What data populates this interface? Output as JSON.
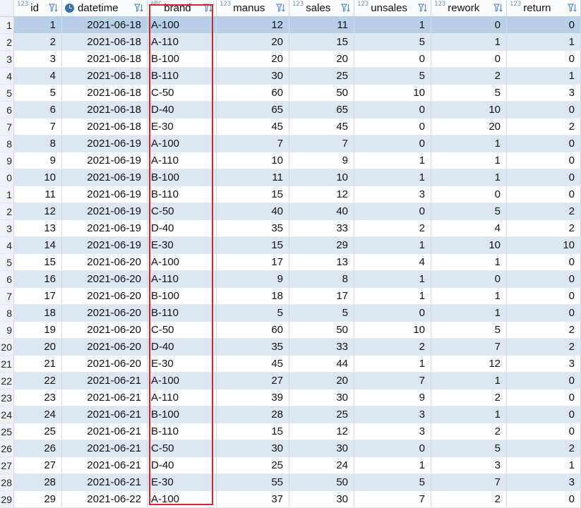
{
  "columns": [
    {
      "name": "id",
      "type_icon": "123",
      "icon": "key-number-icon"
    },
    {
      "name": "datetime",
      "type_icon": "clock",
      "icon": "clock-icon"
    },
    {
      "name": "brand",
      "type_icon": "ABC",
      "icon": "text-type-icon"
    },
    {
      "name": "manus",
      "type_icon": "123",
      "icon": "number-type-icon"
    },
    {
      "name": "sales",
      "type_icon": "123",
      "icon": "number-type-icon"
    },
    {
      "name": "unsales",
      "type_icon": "123",
      "icon": "number-type-icon"
    },
    {
      "name": "rework",
      "type_icon": "123",
      "icon": "number-type-icon"
    },
    {
      "name": "return",
      "type_icon": "123",
      "icon": "number-type-icon"
    }
  ],
  "row_numbers": [
    "1",
    "2",
    "3",
    "4",
    "5",
    "6",
    "7",
    "8",
    "9",
    "0",
    "1",
    "2",
    "3",
    "4",
    "5",
    "6",
    "7",
    "8",
    "9",
    "20",
    "21",
    "22",
    "23",
    "24",
    "25",
    "26",
    "27",
    "28",
    "29"
  ],
  "rows": [
    [
      "1",
      "2021-06-18",
      "A-100",
      "12",
      "11",
      "1",
      "0",
      "0"
    ],
    [
      "2",
      "2021-06-18",
      "A-110",
      "20",
      "15",
      "5",
      "1",
      "1"
    ],
    [
      "3",
      "2021-06-18",
      "B-100",
      "20",
      "20",
      "0",
      "0",
      "0"
    ],
    [
      "4",
      "2021-06-18",
      "B-110",
      "30",
      "25",
      "5",
      "2",
      "1"
    ],
    [
      "5",
      "2021-06-18",
      "C-50",
      "60",
      "50",
      "10",
      "5",
      "3"
    ],
    [
      "6",
      "2021-06-18",
      "D-40",
      "65",
      "65",
      "0",
      "10",
      "0"
    ],
    [
      "7",
      "2021-06-18",
      "E-30",
      "45",
      "45",
      "0",
      "20",
      "2"
    ],
    [
      "8",
      "2021-06-19",
      "A-100",
      "7",
      "7",
      "0",
      "1",
      "0"
    ],
    [
      "9",
      "2021-06-19",
      "A-110",
      "10",
      "9",
      "1",
      "1",
      "0"
    ],
    [
      "10",
      "2021-06-19",
      "B-100",
      "11",
      "10",
      "1",
      "1",
      "0"
    ],
    [
      "11",
      "2021-06-19",
      "B-110",
      "15",
      "12",
      "3",
      "0",
      "0"
    ],
    [
      "12",
      "2021-06-19",
      "C-50",
      "40",
      "40",
      "0",
      "5",
      "2"
    ],
    [
      "13",
      "2021-06-19",
      "D-40",
      "35",
      "33",
      "2",
      "4",
      "2"
    ],
    [
      "14",
      "2021-06-19",
      "E-30",
      "15",
      "29",
      "1",
      "10",
      "10"
    ],
    [
      "15",
      "2021-06-20",
      "A-100",
      "17",
      "13",
      "4",
      "1",
      "0"
    ],
    [
      "16",
      "2021-06-20",
      "A-110",
      "9",
      "8",
      "1",
      "0",
      "0"
    ],
    [
      "17",
      "2021-06-20",
      "B-100",
      "18",
      "17",
      "1",
      "1",
      "0"
    ],
    [
      "18",
      "2021-06-20",
      "B-110",
      "5",
      "5",
      "0",
      "1",
      "0"
    ],
    [
      "19",
      "2021-06-20",
      "C-50",
      "60",
      "50",
      "10",
      "5",
      "2"
    ],
    [
      "20",
      "2021-06-20",
      "D-40",
      "35",
      "33",
      "2",
      "7",
      "2"
    ],
    [
      "21",
      "2021-06-20",
      "E-30",
      "45",
      "44",
      "1",
      "12",
      "3"
    ],
    [
      "22",
      "2021-06-21",
      "A-100",
      "27",
      "20",
      "7",
      "1",
      "0"
    ],
    [
      "23",
      "2021-06-21",
      "A-110",
      "39",
      "30",
      "9",
      "2",
      "0"
    ],
    [
      "24",
      "2021-06-21",
      "B-100",
      "28",
      "25",
      "3",
      "1",
      "0"
    ],
    [
      "25",
      "2021-06-21",
      "B-110",
      "15",
      "12",
      "3",
      "2",
      "0"
    ],
    [
      "26",
      "2021-06-21",
      "C-50",
      "30",
      "30",
      "0",
      "5",
      "2"
    ],
    [
      "27",
      "2021-06-21",
      "D-40",
      "25",
      "24",
      "1",
      "3",
      "1"
    ],
    [
      "28",
      "2021-06-21",
      "E-30",
      "55",
      "50",
      "5",
      "7",
      "3"
    ],
    [
      "29",
      "2021-06-22",
      "A-100",
      "37",
      "30",
      "7",
      "2",
      "0"
    ]
  ],
  "colors": {
    "selected_row": "#b8cfe8",
    "alt_row": "#dde6f2",
    "highlight_box": "#d9232e",
    "type_icon": "#6a8fb9"
  }
}
